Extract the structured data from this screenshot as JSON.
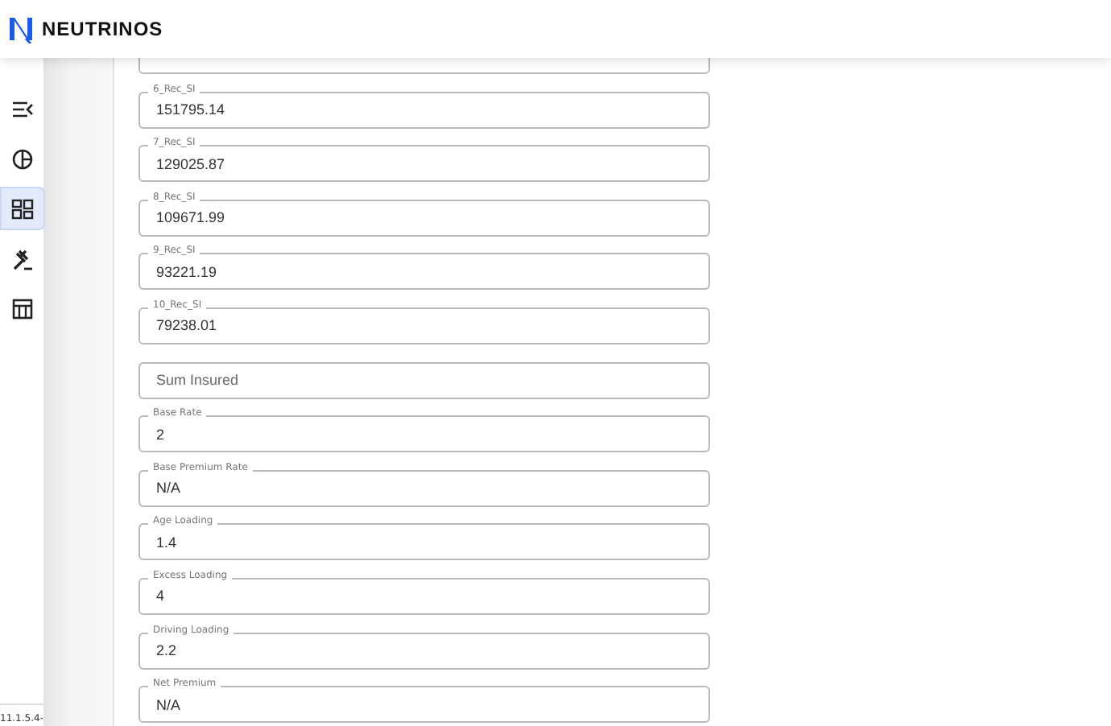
{
  "brand": "NEUTRINOS",
  "sidebar": {
    "items": [
      {
        "selected": false
      },
      {
        "selected": false
      },
      {
        "selected": true
      },
      {
        "selected": false
      },
      {
        "selected": false
      }
    ],
    "version": "11.1.5.4-"
  },
  "fields": [
    {
      "label": "6_Rec_SI",
      "value": "151795.14"
    },
    {
      "label": "7_Rec_SI",
      "value": "129025.87"
    },
    {
      "label": "8_Rec_SI",
      "value": "109671.99"
    },
    {
      "label": "9_Rec_SI",
      "value": "93221.19"
    },
    {
      "label": "10_Rec_SI",
      "value": "79238.01"
    },
    {
      "placeholder": "Sum Insured"
    },
    {
      "label": "Base Rate",
      "value": "2"
    },
    {
      "label": "Base Premium Rate",
      "value": "N/A"
    },
    {
      "label": "Age Loading",
      "value": "1.4"
    },
    {
      "label": "Excess Loading",
      "value": "4"
    },
    {
      "label": "Driving Loading",
      "value": "2.2"
    },
    {
      "label": "Net Premium",
      "value": "N/A"
    }
  ]
}
